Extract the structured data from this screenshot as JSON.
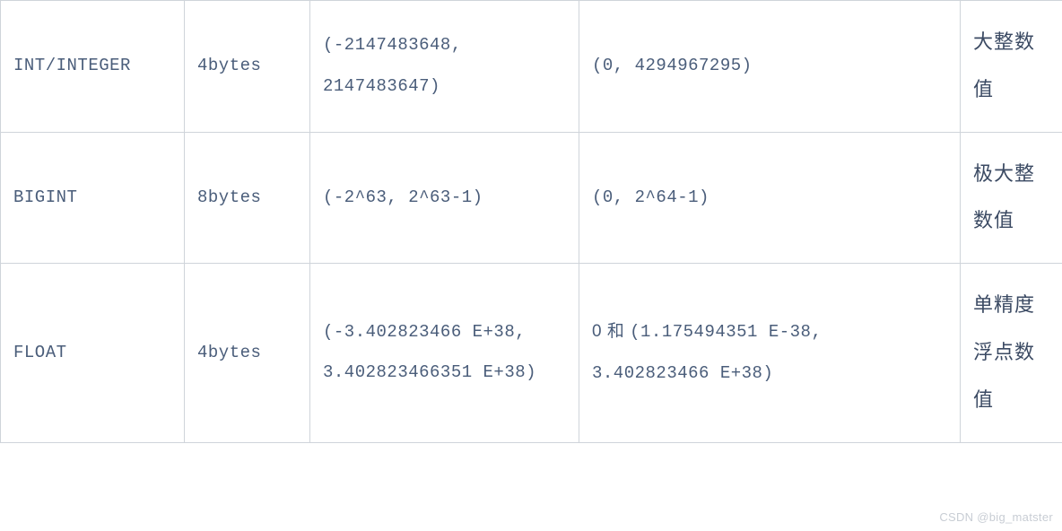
{
  "table": {
    "rows": [
      {
        "type_name": "INT/INTEGER",
        "size": "4bytes",
        "signed_range": "(-2147483648, 2147483647)",
        "unsigned_range": "(0, 4294967295)",
        "description": "大整数值"
      },
      {
        "type_name": "BIGINT",
        "size": "8bytes",
        "signed_range": "(-2^63, 2^63-1)",
        "unsigned_range": "(0, 2^64-1)",
        "description": "极大整数值"
      },
      {
        "type_name": "FLOAT",
        "size": "4bytes",
        "signed_range": "(-3.402823466 E+38, 3.402823466351 E+38)",
        "unsigned_range_prefix": "0 和 ",
        "unsigned_range": "(1.175494351 E-38, 3.402823466 E+38)",
        "description": "单精度浮点数值"
      }
    ]
  },
  "watermark": "CSDN @big_matster"
}
